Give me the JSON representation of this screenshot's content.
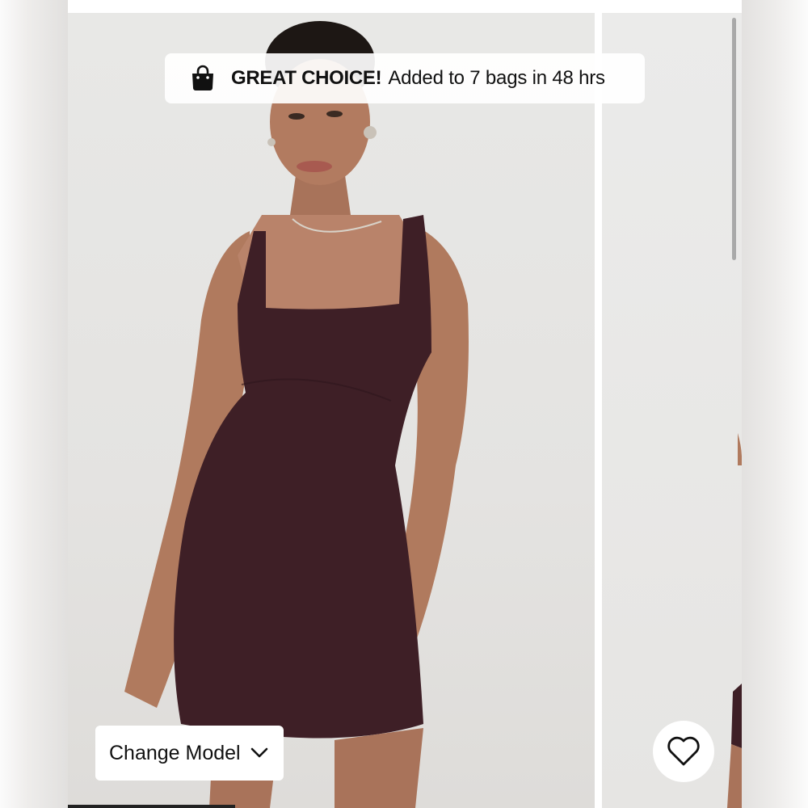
{
  "toast": {
    "icon": "shopping-bag-icon",
    "headline": "GREAT CHOICE!",
    "message": "Added to 7 bags in 48 hrs"
  },
  "model_selector": {
    "label": "Change Model",
    "icon": "chevron-down-icon"
  },
  "wishlist": {
    "icon": "heart-icon"
  },
  "colors": {
    "dress": "#3e1f26",
    "background": "#e6e5e3",
    "text": "#111111"
  }
}
